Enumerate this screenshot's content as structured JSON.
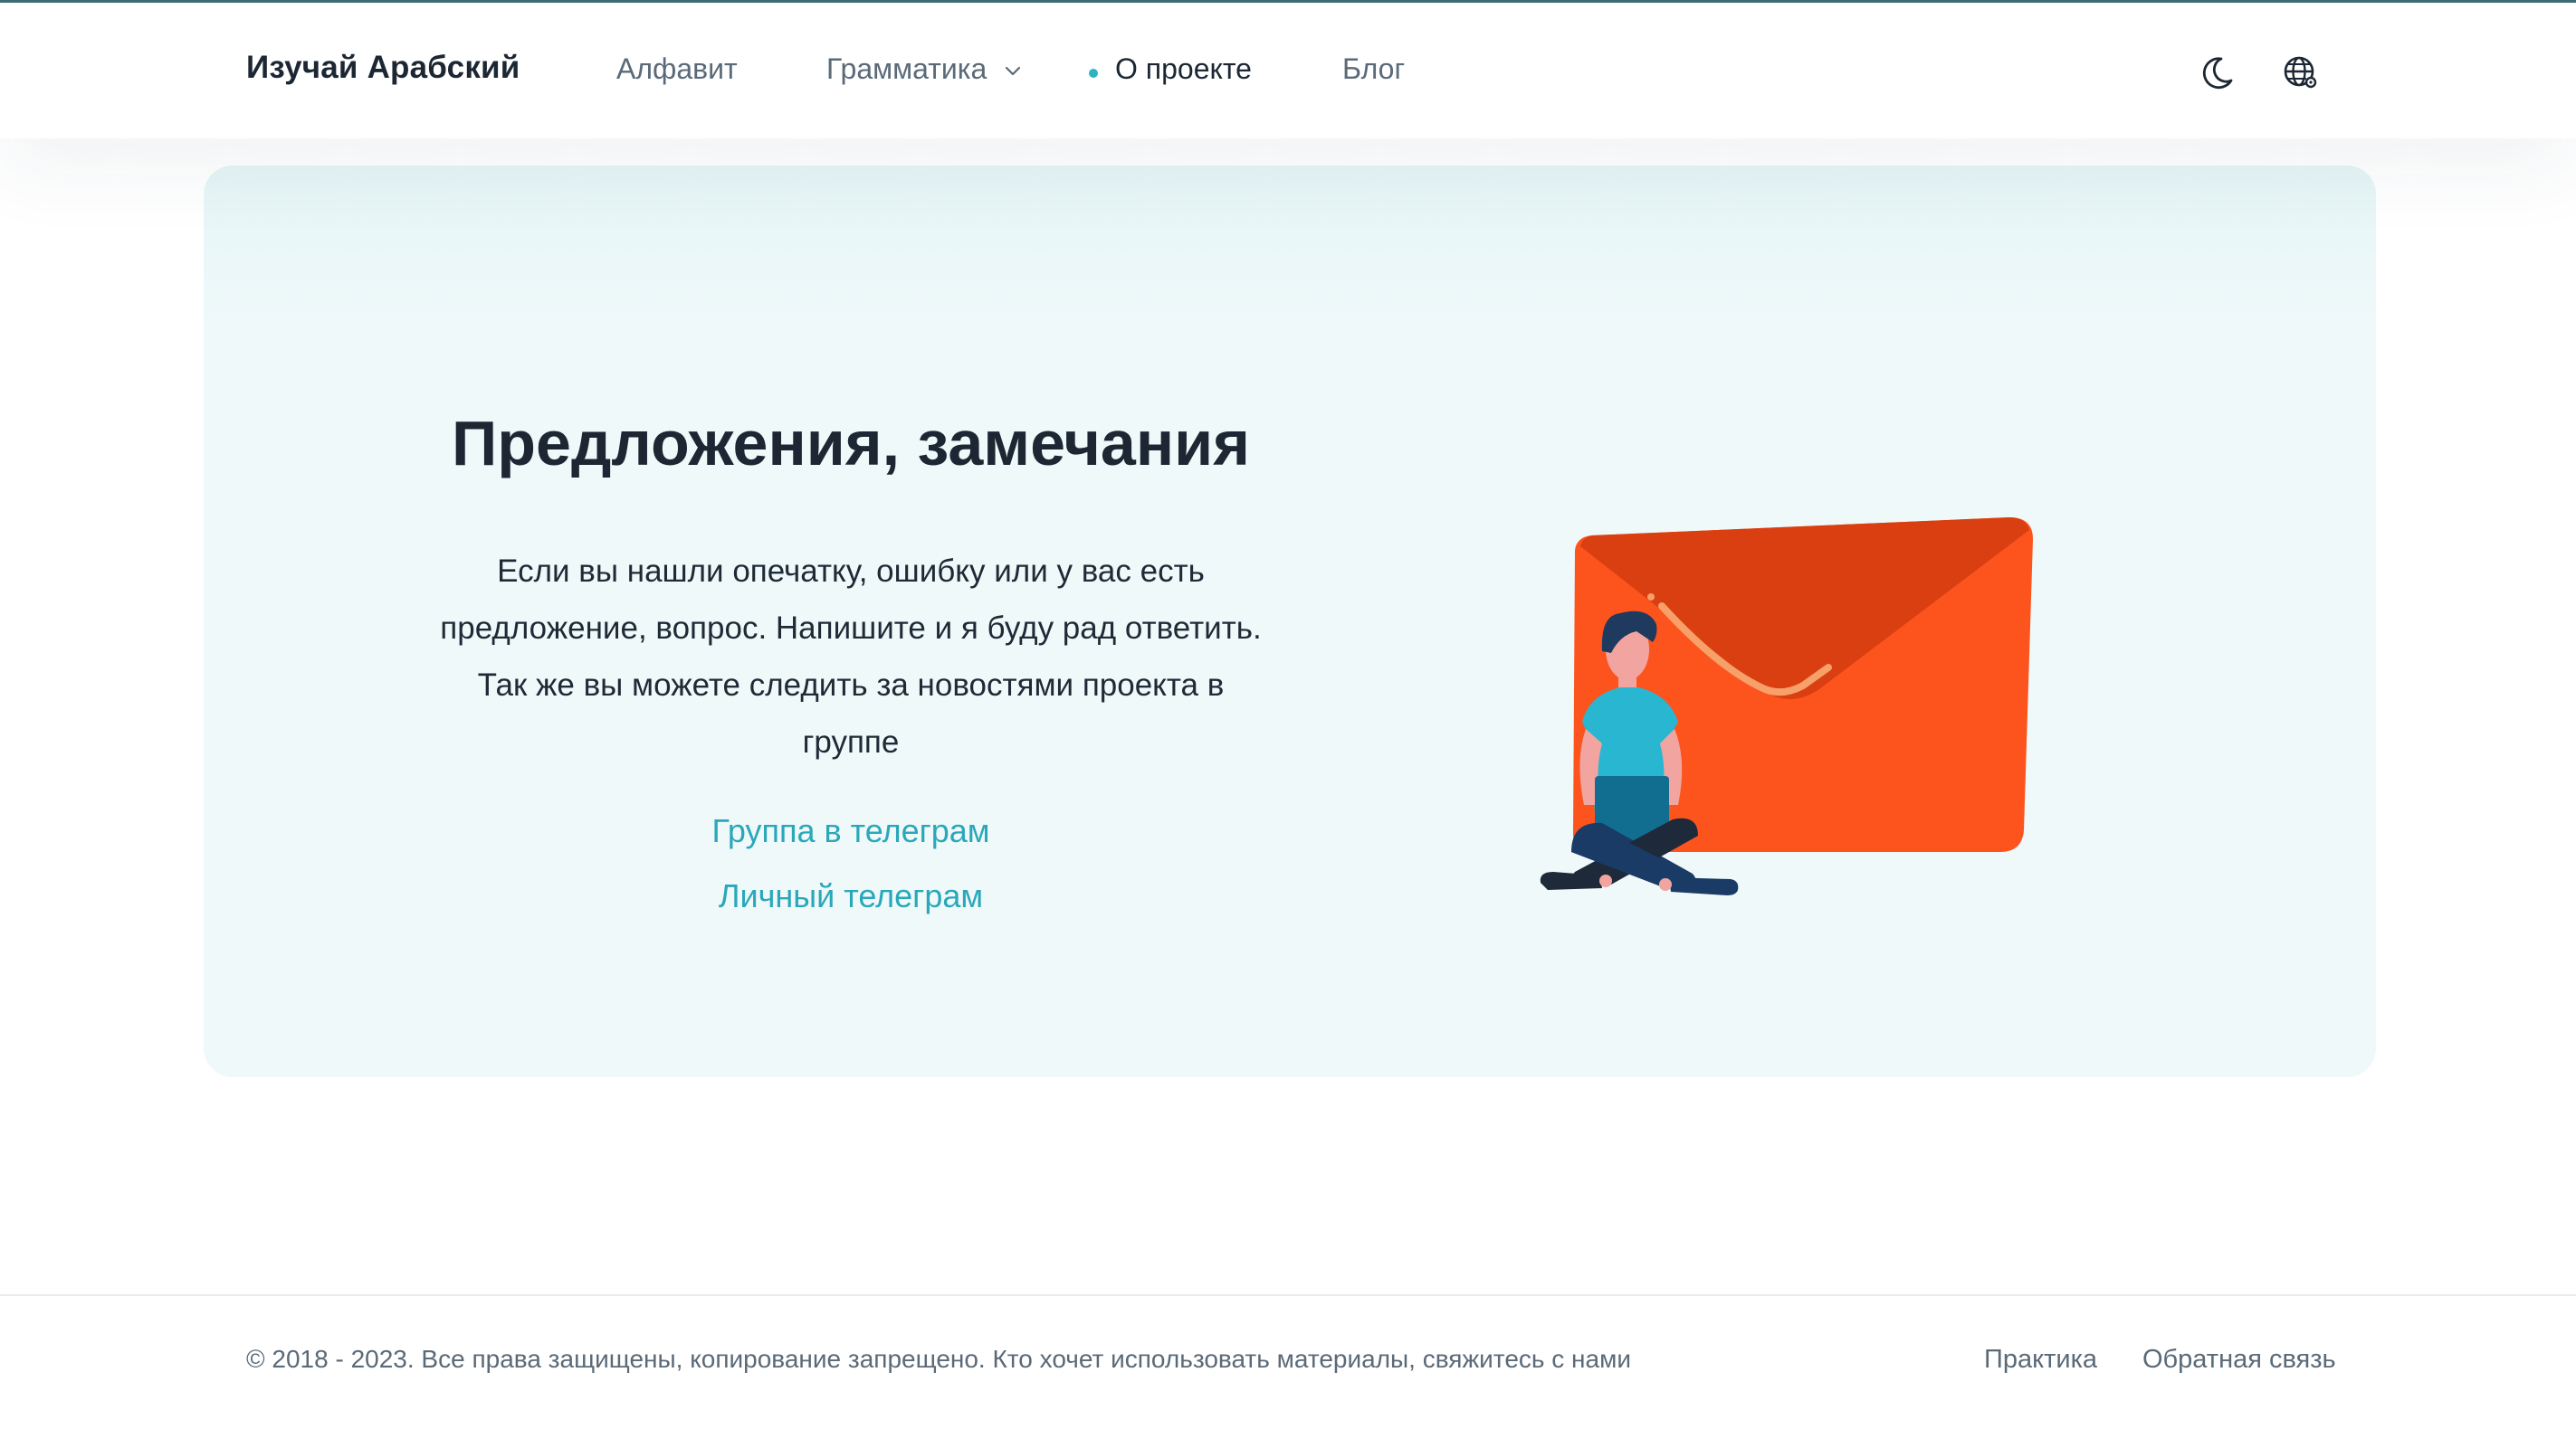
{
  "header": {
    "brand": "Изучай Арабский",
    "nav": [
      {
        "label": "Алфавит",
        "active": false
      },
      {
        "label": "Грамматика",
        "active": false,
        "has_dropdown": true
      },
      {
        "label": "О проекте",
        "active": true
      },
      {
        "label": "Блог",
        "active": false
      }
    ],
    "icons": [
      "moon-icon",
      "globe-icon"
    ]
  },
  "main": {
    "title": "Предложения, замечания",
    "text": "Если вы нашли опечатку, ошибку или у вас есть предложение, вопрос. Напишите и я буду рад ответить. Так же вы можете следить за новостями проекта в группе",
    "links": [
      "Группа в телеграм",
      "Личный телеграм"
    ]
  },
  "footer": {
    "copyright": "© 2018 - 2023. Все права защищены, копирование запрещено. Кто хочет использовать материалы, свяжитесь с нами",
    "links": [
      "Практика",
      "Обратная связь"
    ]
  },
  "colors": {
    "accent": "#2cb3c4",
    "link": "#2aa8b9",
    "card_bg": "#eff9fa",
    "envelope": "#fd541e",
    "text_dark": "#1c2733",
    "text_muted": "#5b6a78"
  }
}
